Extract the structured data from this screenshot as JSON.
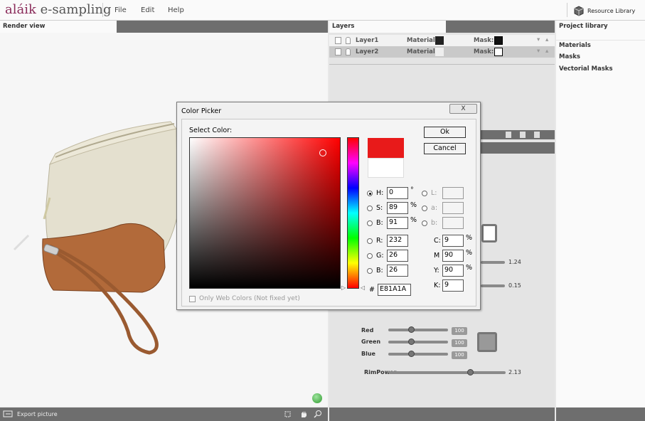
{
  "app": {
    "logo": "e-sampling",
    "logo_mark": "aláik"
  },
  "menu": {
    "file": "File",
    "edit": "Edit",
    "help": "Help"
  },
  "resource_library": "Resource Library",
  "render_view": {
    "title": "Render view",
    "export_label": "Export picture"
  },
  "layers_panel": {
    "title": "Layers",
    "rows": [
      {
        "name": "Layer1",
        "material_label": "Material:",
        "mask_label": "Mask:"
      },
      {
        "name": "Layer2",
        "material_label": "Material:",
        "mask_label": "Mask:"
      }
    ]
  },
  "project_library": {
    "title": "Project library",
    "items": [
      "Materials",
      "Masks",
      "Vectorial Masks"
    ]
  },
  "properties": {
    "value_1": "1.24",
    "value_2": "0.15",
    "red_label": "Red",
    "red_value": "100",
    "green_label": "Green",
    "green_value": "100",
    "blue_label": "Blue",
    "blue_value": "100",
    "rimpower_label": "RimPower",
    "rimpower_value": "2.13"
  },
  "color_picker": {
    "title": "Color Picker",
    "close": "X",
    "select_label": "Select Color:",
    "ok": "Ok",
    "cancel": "Cancel",
    "h_label": "H:",
    "h_value": "0",
    "h_unit": "°",
    "s_label": "S:",
    "s_value": "89",
    "s_unit": "%",
    "b_label": "B:",
    "b_value": "91",
    "b_unit": "%",
    "r_label": "R:",
    "r_value": "232",
    "g_label": "G:",
    "g_value": "26",
    "bb_label": "B:",
    "bb_value": "26",
    "l_label": "L:",
    "a_label": "a:",
    "lab_b_label": "b:",
    "c_label": "C:",
    "c_value": "9",
    "m_label": "M",
    "m_value": "90",
    "y_label": "Y:",
    "y_value": "90",
    "k_label": "K:",
    "k_value": "9",
    "hex_label": "#",
    "hex_value": "E81A1A",
    "web_only": "Only Web Colors (Not fixed yet)",
    "new_color": "#e81a1a",
    "old_color": "#ffffff"
  }
}
